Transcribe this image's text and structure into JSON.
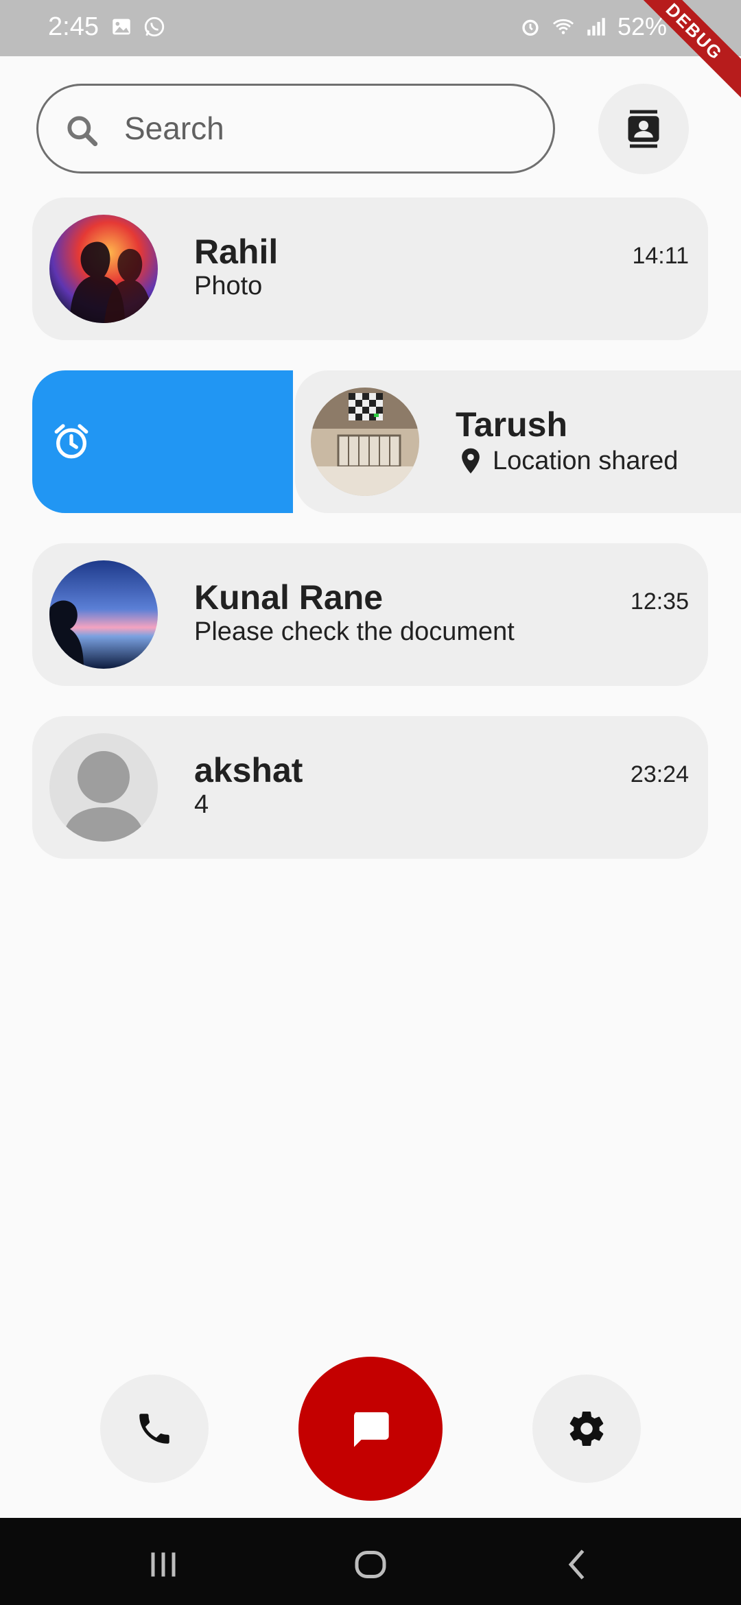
{
  "status_bar": {
    "time": "2:45",
    "battery": "52%",
    "debug_label": "DEBUG"
  },
  "search": {
    "placeholder": "Search"
  },
  "chats": [
    {
      "name": "Rahil",
      "preview": "Photo",
      "time": "14:11"
    },
    {
      "name": "Tarush",
      "preview": "Location shared",
      "time": ""
    },
    {
      "name": "Kunal Rane",
      "preview": "Please check the document",
      "time": "12:35"
    },
    {
      "name": "akshat",
      "preview": "4",
      "time": "23:24"
    }
  ],
  "swipe_action": {
    "icon": "alarm-icon",
    "color": "#2196f3"
  },
  "bottom_nav": {
    "items": [
      {
        "icon": "phone-icon"
      },
      {
        "icon": "chat-icon",
        "active_color": "#c40000"
      },
      {
        "icon": "gear-icon"
      }
    ]
  },
  "system_nav": {
    "items": [
      {
        "icon": "recent-apps-icon"
      },
      {
        "icon": "home-icon"
      },
      {
        "icon": "back-icon"
      }
    ]
  }
}
